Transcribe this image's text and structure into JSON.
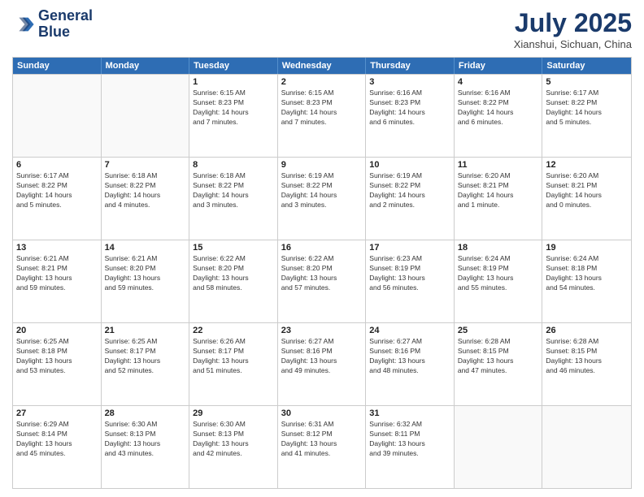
{
  "header": {
    "logo_line1": "General",
    "logo_line2": "Blue",
    "month": "July 2025",
    "location": "Xianshui, Sichuan, China"
  },
  "days_of_week": [
    "Sunday",
    "Monday",
    "Tuesday",
    "Wednesday",
    "Thursday",
    "Friday",
    "Saturday"
  ],
  "weeks": [
    [
      {
        "day": "",
        "empty": true
      },
      {
        "day": "",
        "empty": true
      },
      {
        "day": "1",
        "lines": [
          "Sunrise: 6:15 AM",
          "Sunset: 8:23 PM",
          "Daylight: 14 hours",
          "and 7 minutes."
        ]
      },
      {
        "day": "2",
        "lines": [
          "Sunrise: 6:15 AM",
          "Sunset: 8:23 PM",
          "Daylight: 14 hours",
          "and 7 minutes."
        ]
      },
      {
        "day": "3",
        "lines": [
          "Sunrise: 6:16 AM",
          "Sunset: 8:23 PM",
          "Daylight: 14 hours",
          "and 6 minutes."
        ]
      },
      {
        "day": "4",
        "lines": [
          "Sunrise: 6:16 AM",
          "Sunset: 8:22 PM",
          "Daylight: 14 hours",
          "and 6 minutes."
        ]
      },
      {
        "day": "5",
        "lines": [
          "Sunrise: 6:17 AM",
          "Sunset: 8:22 PM",
          "Daylight: 14 hours",
          "and 5 minutes."
        ]
      }
    ],
    [
      {
        "day": "6",
        "lines": [
          "Sunrise: 6:17 AM",
          "Sunset: 8:22 PM",
          "Daylight: 14 hours",
          "and 5 minutes."
        ]
      },
      {
        "day": "7",
        "lines": [
          "Sunrise: 6:18 AM",
          "Sunset: 8:22 PM",
          "Daylight: 14 hours",
          "and 4 minutes."
        ]
      },
      {
        "day": "8",
        "lines": [
          "Sunrise: 6:18 AM",
          "Sunset: 8:22 PM",
          "Daylight: 14 hours",
          "and 3 minutes."
        ]
      },
      {
        "day": "9",
        "lines": [
          "Sunrise: 6:19 AM",
          "Sunset: 8:22 PM",
          "Daylight: 14 hours",
          "and 3 minutes."
        ]
      },
      {
        "day": "10",
        "lines": [
          "Sunrise: 6:19 AM",
          "Sunset: 8:22 PM",
          "Daylight: 14 hours",
          "and 2 minutes."
        ]
      },
      {
        "day": "11",
        "lines": [
          "Sunrise: 6:20 AM",
          "Sunset: 8:21 PM",
          "Daylight: 14 hours",
          "and 1 minute."
        ]
      },
      {
        "day": "12",
        "lines": [
          "Sunrise: 6:20 AM",
          "Sunset: 8:21 PM",
          "Daylight: 14 hours",
          "and 0 minutes."
        ]
      }
    ],
    [
      {
        "day": "13",
        "lines": [
          "Sunrise: 6:21 AM",
          "Sunset: 8:21 PM",
          "Daylight: 13 hours",
          "and 59 minutes."
        ]
      },
      {
        "day": "14",
        "lines": [
          "Sunrise: 6:21 AM",
          "Sunset: 8:20 PM",
          "Daylight: 13 hours",
          "and 59 minutes."
        ]
      },
      {
        "day": "15",
        "lines": [
          "Sunrise: 6:22 AM",
          "Sunset: 8:20 PM",
          "Daylight: 13 hours",
          "and 58 minutes."
        ]
      },
      {
        "day": "16",
        "lines": [
          "Sunrise: 6:22 AM",
          "Sunset: 8:20 PM",
          "Daylight: 13 hours",
          "and 57 minutes."
        ]
      },
      {
        "day": "17",
        "lines": [
          "Sunrise: 6:23 AM",
          "Sunset: 8:19 PM",
          "Daylight: 13 hours",
          "and 56 minutes."
        ]
      },
      {
        "day": "18",
        "lines": [
          "Sunrise: 6:24 AM",
          "Sunset: 8:19 PM",
          "Daylight: 13 hours",
          "and 55 minutes."
        ]
      },
      {
        "day": "19",
        "lines": [
          "Sunrise: 6:24 AM",
          "Sunset: 8:18 PM",
          "Daylight: 13 hours",
          "and 54 minutes."
        ]
      }
    ],
    [
      {
        "day": "20",
        "lines": [
          "Sunrise: 6:25 AM",
          "Sunset: 8:18 PM",
          "Daylight: 13 hours",
          "and 53 minutes."
        ]
      },
      {
        "day": "21",
        "lines": [
          "Sunrise: 6:25 AM",
          "Sunset: 8:17 PM",
          "Daylight: 13 hours",
          "and 52 minutes."
        ]
      },
      {
        "day": "22",
        "lines": [
          "Sunrise: 6:26 AM",
          "Sunset: 8:17 PM",
          "Daylight: 13 hours",
          "and 51 minutes."
        ]
      },
      {
        "day": "23",
        "lines": [
          "Sunrise: 6:27 AM",
          "Sunset: 8:16 PM",
          "Daylight: 13 hours",
          "and 49 minutes."
        ]
      },
      {
        "day": "24",
        "lines": [
          "Sunrise: 6:27 AM",
          "Sunset: 8:16 PM",
          "Daylight: 13 hours",
          "and 48 minutes."
        ]
      },
      {
        "day": "25",
        "lines": [
          "Sunrise: 6:28 AM",
          "Sunset: 8:15 PM",
          "Daylight: 13 hours",
          "and 47 minutes."
        ]
      },
      {
        "day": "26",
        "lines": [
          "Sunrise: 6:28 AM",
          "Sunset: 8:15 PM",
          "Daylight: 13 hours",
          "and 46 minutes."
        ]
      }
    ],
    [
      {
        "day": "27",
        "lines": [
          "Sunrise: 6:29 AM",
          "Sunset: 8:14 PM",
          "Daylight: 13 hours",
          "and 45 minutes."
        ]
      },
      {
        "day": "28",
        "lines": [
          "Sunrise: 6:30 AM",
          "Sunset: 8:13 PM",
          "Daylight: 13 hours",
          "and 43 minutes."
        ]
      },
      {
        "day": "29",
        "lines": [
          "Sunrise: 6:30 AM",
          "Sunset: 8:13 PM",
          "Daylight: 13 hours",
          "and 42 minutes."
        ]
      },
      {
        "day": "30",
        "lines": [
          "Sunrise: 6:31 AM",
          "Sunset: 8:12 PM",
          "Daylight: 13 hours",
          "and 41 minutes."
        ]
      },
      {
        "day": "31",
        "lines": [
          "Sunrise: 6:32 AM",
          "Sunset: 8:11 PM",
          "Daylight: 13 hours",
          "and 39 minutes."
        ]
      },
      {
        "day": "",
        "empty": true
      },
      {
        "day": "",
        "empty": true
      }
    ]
  ]
}
